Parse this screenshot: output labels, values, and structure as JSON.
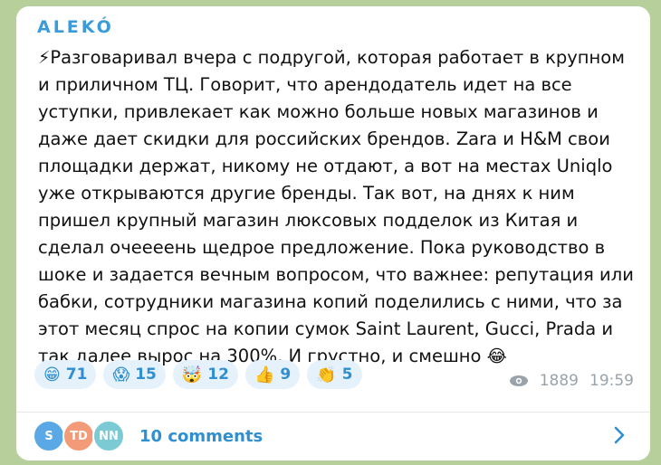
{
  "channel": {
    "name": "ALEKÓ"
  },
  "message": {
    "lead_icon": "lightning-emoji",
    "text": "Разговаривал вчера с подругой, которая работает в крупном и приличном ТЦ. Говорит, что арендодатель идет на все уступки, привлекает как можно больше новых магазинов и даже дает скидки для российских брендов. Zara и H&M свои площадки держат, никому не отдают, а вот на местах Uniqlo уже открываются другие бренды. Так вот, на днях к ним пришел крупный магазин люксовых подделок из Китая и сделал очеееень щедрое предложение. Пока руководство в шоке и задается вечным вопросом, что важнее: репутация или бабки, сотрудники магазина копий поделились с ними, что за этот месяц спрос на копии сумок Saint Laurent, Gucci, Prada и так далее вырос на 300%. И грустно, и смешно",
    "trail_icon": "laughing-tears-emoji"
  },
  "reactions": [
    {
      "icon": "grinning-face-icon",
      "glyph": "😁",
      "count": "71"
    },
    {
      "icon": "scream-face-icon",
      "glyph": "😱",
      "count": "15"
    },
    {
      "icon": "exploding-head-icon",
      "glyph": "🤯",
      "count": "12"
    },
    {
      "icon": "thumbs-up-icon",
      "glyph": "👍",
      "count": "9"
    },
    {
      "icon": "clapping-hands-icon",
      "glyph": "👏",
      "count": "5"
    }
  ],
  "meta": {
    "views": "1889",
    "time": "19:59"
  },
  "comments": {
    "avatars": [
      {
        "initials": "S",
        "color": "#5aa9e6"
      },
      {
        "initials": "TD",
        "color": "#f39a78"
      },
      {
        "initials": "NN",
        "color": "#7ccad4"
      }
    ],
    "label": "10 comments"
  },
  "colors": {
    "accent": "#2f8fd0",
    "reaction_bg": "#e6f2fb",
    "muted": "#9aa3aa"
  }
}
